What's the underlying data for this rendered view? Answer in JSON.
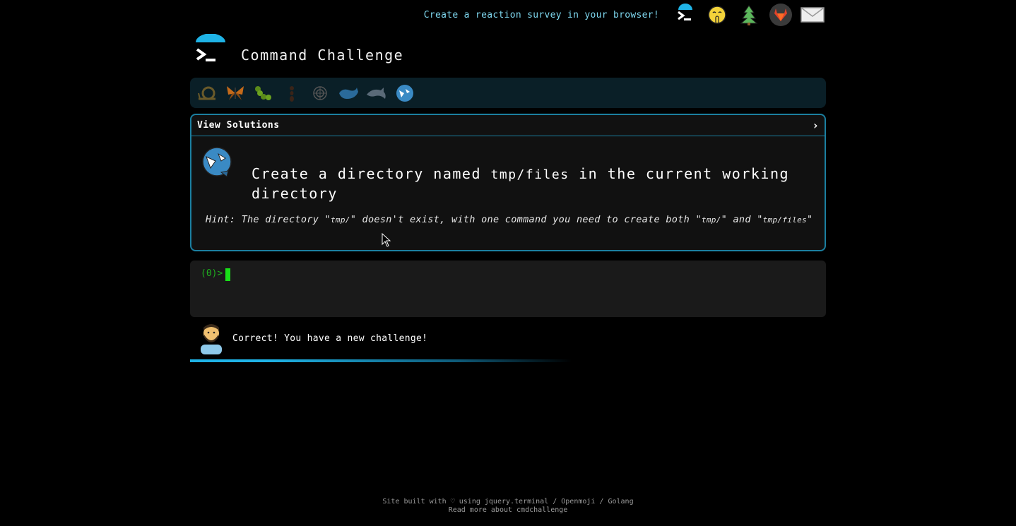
{
  "topbar": {
    "survey_link": "Create a reaction survey in your browser!",
    "icons": [
      "terminal-icon",
      "shushing-face-icon",
      "tree-icon",
      "gitlab-icon",
      "mail-icon"
    ]
  },
  "header": {
    "title": "Command Challenge"
  },
  "badges": [
    "snail",
    "butterfly",
    "caterpillar",
    "ant",
    "shell",
    "whale",
    "dolphin",
    "orca"
  ],
  "challenge": {
    "view_solutions": "View Solutions",
    "chevron": "›",
    "text_pre": "Create a directory named ",
    "text_code": "tmp/files",
    "text_post": " in the current working directory",
    "hint_1": "Hint: The directory \"",
    "hint_c1": "tmp/",
    "hint_2": "\" doesn't exist, with one command you need to create both \"",
    "hint_c2": "tmp/",
    "hint_3": "\" and \"",
    "hint_c3": "tmp/files",
    "hint_4": "\""
  },
  "terminal": {
    "prompt": "(0)>"
  },
  "feedback": {
    "message": "Correct! You have a new challenge!",
    "progress_percent": 60
  },
  "footer": {
    "line1": "Site built with ♡ using jquery.terminal / Openmoji / Golang",
    "line2": "Read more about cmdchallenge"
  },
  "colors": {
    "accent": "#1b7fa0",
    "prompt": "#1fae1f",
    "link": "#7fd8f0"
  }
}
